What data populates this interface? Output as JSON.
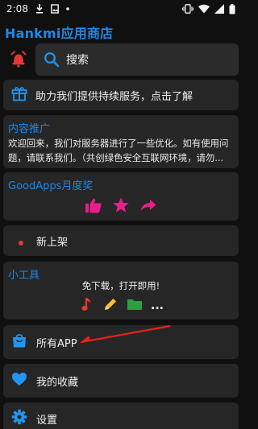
{
  "status_bar": {
    "time": "2:08",
    "icons": [
      "download-icon",
      "image-icon",
      "dot-icon",
      "vibrate-icon",
      "wifi-icon",
      "signal-icon",
      "battery-icon"
    ]
  },
  "app": {
    "title": "Hankmi应用商店"
  },
  "search": {
    "placeholder": "搜索"
  },
  "support": {
    "label": "助力我们提供持续服务，点击了解"
  },
  "promo": {
    "title": "内容推广",
    "line1": "欢迎回来，我们对服务器进行了一些优化。如有使用问题，请联系我们。（共创绿色安全互联网环境，请勿",
    "line1_visible": "欢迎回来，我们对服务器进行了一些优化。如有使用问",
    "line2_visible": "题，请联系我们。（共创绿色安全互联网环境，请勿..."
  },
  "goodapps": {
    "title": "GoodApps月度奖",
    "icons": [
      "thumb-up-icon",
      "star-icon",
      "share-icon"
    ]
  },
  "new_releases": {
    "label": "新上架"
  },
  "tools": {
    "title": "小工具",
    "text": "免下载，打开即用!",
    "icons": [
      "music-note-icon",
      "pencil-icon",
      "folder-icon",
      "more-icon"
    ],
    "more": "..."
  },
  "menu": {
    "all_apps": "所有APP",
    "favorites": "我的收藏",
    "settings": "设置"
  },
  "colors": {
    "accent_blue": "#1e88e5",
    "pink": "#e91e8c",
    "alarm_red": "#e53935",
    "red_dot": "#e53935",
    "music_red": "#e53935",
    "pencil_yellow": "#fbc02d",
    "folder_green": "#2e9e3e",
    "arrow_red": "#e8201a"
  }
}
